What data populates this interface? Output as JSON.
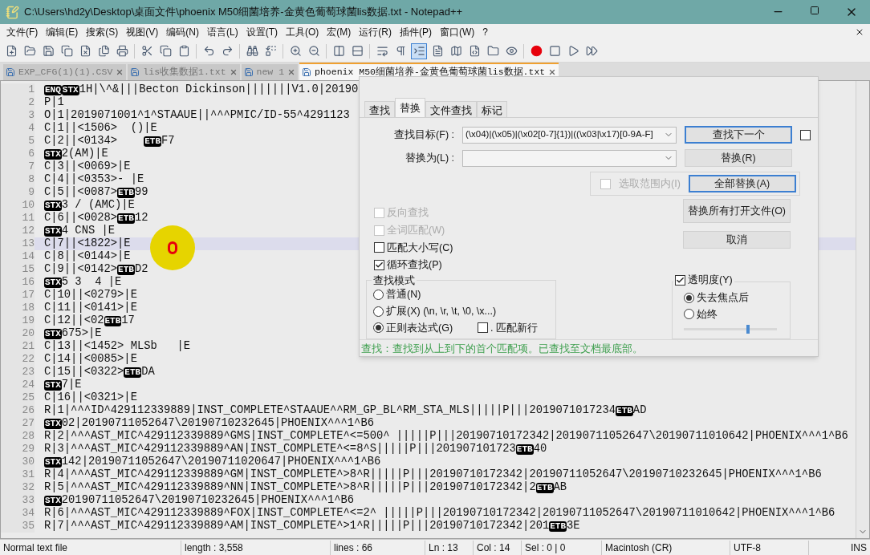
{
  "window": {
    "title": "C:\\Users\\hd2y\\Desktop\\桌面文件\\phoenix M50细菌培养-金黄色葡萄球菌lis数据.txt - Notepad++"
  },
  "menu": [
    "文件(F)",
    "编辑(E)",
    "搜索(S)",
    "视图(V)",
    "编码(N)",
    "语言(L)",
    "设置(T)",
    "工具(O)",
    "宏(M)",
    "运行(R)",
    "插件(P)",
    "窗口(W)",
    "?"
  ],
  "tabs": [
    {
      "label": "EXP_CFG(1)(1).CSV",
      "selected": false
    },
    {
      "label": "lis收集数据1.txt",
      "selected": false
    },
    {
      "label": "new 1",
      "selected": false
    },
    {
      "label": "phoenix M50细菌培养-金黄色葡萄球菌lis数据.txt",
      "selected": true
    }
  ],
  "editor": {
    "lines": [
      {
        "number": "1",
        "current": false,
        "segments": [
          {
            "kind": "ctrl",
            "text": "ENQ"
          },
          {
            "kind": "ctrl",
            "text": "STX"
          },
          {
            "kind": "text",
            "text": "1H|\\^&|||Becton Dickinson|||||||V1.0|20190"
          }
        ]
      },
      {
        "number": "2",
        "current": false,
        "segments": [
          {
            "kind": "text",
            "text": "P|1"
          }
        ]
      },
      {
        "number": "3",
        "current": false,
        "segments": [
          {
            "kind": "text",
            "text": "O|1|2019071001^1^STAAUE||^^^PMIC/ID-55^4291123"
          }
        ]
      },
      {
        "number": "4",
        "current": false,
        "segments": [
          {
            "kind": "text",
            "text": "C|1||<1506>  ()|E"
          }
        ]
      },
      {
        "number": "5",
        "current": false,
        "segments": [
          {
            "kind": "text",
            "text": "C|2||<0134>    "
          },
          {
            "kind": "ctrl",
            "text": "ETB"
          },
          {
            "kind": "text",
            "text": "F7"
          }
        ]
      },
      {
        "number": "6",
        "current": false,
        "segments": [
          {
            "kind": "ctrl",
            "text": "STX"
          },
          {
            "kind": "text",
            "text": "2(AM)|E"
          }
        ]
      },
      {
        "number": "7",
        "current": false,
        "segments": [
          {
            "kind": "text",
            "text": "C|3||<0069>|E"
          }
        ]
      },
      {
        "number": "8",
        "current": false,
        "segments": [
          {
            "kind": "text",
            "text": "C|4||<0353>- |E"
          }
        ]
      },
      {
        "number": "9",
        "current": false,
        "segments": [
          {
            "kind": "text",
            "text": "C|5||<0087>"
          },
          {
            "kind": "ctrl",
            "text": "ETB"
          },
          {
            "kind": "text",
            "text": "99"
          }
        ]
      },
      {
        "number": "10",
        "current": false,
        "segments": [
          {
            "kind": "ctrl",
            "text": "STX"
          },
          {
            "kind": "text",
            "text": "3 / (AMC)|E"
          }
        ]
      },
      {
        "number": "11",
        "current": false,
        "segments": [
          {
            "kind": "text",
            "text": "C|6||<0028>"
          },
          {
            "kind": "ctrl",
            "text": "ETB"
          },
          {
            "kind": "text",
            "text": "12"
          }
        ]
      },
      {
        "number": "12",
        "current": false,
        "segments": [
          {
            "kind": "ctrl",
            "text": "STX"
          },
          {
            "kind": "text",
            "text": "4 CNS |E"
          }
        ]
      },
      {
        "number": "13",
        "current": true,
        "segments": [
          {
            "kind": "text",
            "text": "C|7||<1822>|E"
          }
        ]
      },
      {
        "number": "14",
        "current": false,
        "segments": [
          {
            "kind": "text",
            "text": "C|8||<0144>|E"
          }
        ]
      },
      {
        "number": "15",
        "current": false,
        "segments": [
          {
            "kind": "text",
            "text": "C|9||<0142>"
          },
          {
            "kind": "ctrl",
            "text": "ETB"
          },
          {
            "kind": "text",
            "text": "D2"
          }
        ]
      },
      {
        "number": "16",
        "current": false,
        "segments": [
          {
            "kind": "ctrl",
            "text": "STX"
          },
          {
            "kind": "text",
            "text": "5 3  4 |E"
          }
        ]
      },
      {
        "number": "17",
        "current": false,
        "segments": [
          {
            "kind": "text",
            "text": "C|10||<0279>|E"
          }
        ]
      },
      {
        "number": "18",
        "current": false,
        "segments": [
          {
            "kind": "text",
            "text": "C|11||<0141>|E"
          }
        ]
      },
      {
        "number": "19",
        "current": false,
        "segments": [
          {
            "kind": "text",
            "text": "C|12||<02"
          },
          {
            "kind": "ctrl",
            "text": "ETB"
          },
          {
            "kind": "text",
            "text": "17"
          }
        ]
      },
      {
        "number": "20",
        "current": false,
        "segments": [
          {
            "kind": "ctrl",
            "text": "STX"
          },
          {
            "kind": "text",
            "text": "675>|E"
          }
        ]
      },
      {
        "number": "21",
        "current": false,
        "segments": [
          {
            "kind": "text",
            "text": "C|13||<1452> MLSb   |E"
          }
        ]
      },
      {
        "number": "22",
        "current": false,
        "segments": [
          {
            "kind": "text",
            "text": "C|14||<0085>|E"
          }
        ]
      },
      {
        "number": "23",
        "current": false,
        "segments": [
          {
            "kind": "text",
            "text": "C|15||<0322>"
          },
          {
            "kind": "ctrl",
            "text": "ETB"
          },
          {
            "kind": "text",
            "text": "DA"
          }
        ]
      },
      {
        "number": "24",
        "current": false,
        "segments": [
          {
            "kind": "ctrl",
            "text": "STX"
          },
          {
            "kind": "text",
            "text": "7|E"
          }
        ]
      },
      {
        "number": "25",
        "current": false,
        "segments": [
          {
            "kind": "text",
            "text": "C|16||<0321>|E"
          }
        ]
      },
      {
        "number": "26",
        "current": false,
        "segments": [
          {
            "kind": "text",
            "text": "R|1|^^^ID^429112339889|INST_COMPLETE^STAAUE^^RM_GP_BL^RM_STA_MLS|||||P|||2019071017234"
          },
          {
            "kind": "ctrl",
            "text": "ETB"
          },
          {
            "kind": "text",
            "text": "AD"
          }
        ]
      },
      {
        "number": "27",
        "current": false,
        "segments": [
          {
            "kind": "ctrl",
            "text": "STX"
          },
          {
            "kind": "text",
            "text": "02|20190711052647\\20190710232645|PHOENIX^^^1^B6"
          }
        ]
      },
      {
        "number": "28",
        "current": false,
        "segments": [
          {
            "kind": "text",
            "text": "R|2|^^^AST_MIC^429112339889^GMS|INST_COMPLETE^<=500^ |||||P|||20190710172342|20190711052647\\20190711010642|PHOENIX^^^1^B6"
          }
        ]
      },
      {
        "number": "29",
        "current": false,
        "segments": [
          {
            "kind": "text",
            "text": "R|3|^^^AST_MIC^429112339889^AN|INST_COMPLETE^<=8^S|||||P|||201907101723"
          },
          {
            "kind": "ctrl",
            "text": "ETB"
          },
          {
            "kind": "text",
            "text": "40"
          }
        ]
      },
      {
        "number": "30",
        "current": false,
        "segments": [
          {
            "kind": "ctrl",
            "text": "STX"
          },
          {
            "kind": "text",
            "text": "142|20190711052647\\20190711020647|PHOENIX^^^1^B6"
          }
        ]
      },
      {
        "number": "31",
        "current": false,
        "segments": [
          {
            "kind": "text",
            "text": "R|4|^^^AST_MIC^429112339889^GM|INST_COMPLETE^>8^R|||||P|||20190710172342|20190711052647\\20190710232645|PHOENIX^^^1^B6"
          }
        ]
      },
      {
        "number": "32",
        "current": false,
        "segments": [
          {
            "kind": "text",
            "text": "R|5|^^^AST_MIC^429112339889^NN|INST_COMPLETE^>8^R|||||P|||20190710172342|2"
          },
          {
            "kind": "ctrl",
            "text": "ETB"
          },
          {
            "kind": "text",
            "text": "AB"
          }
        ]
      },
      {
        "number": "33",
        "current": false,
        "segments": [
          {
            "kind": "ctrl",
            "text": "STX"
          },
          {
            "kind": "text",
            "text": "20190711052647\\20190710232645|PHOENIX^^^1^B6"
          }
        ]
      },
      {
        "number": "34",
        "current": false,
        "segments": [
          {
            "kind": "text",
            "text": "R|6|^^^AST_MIC^429112339889^FOX|INST_COMPLETE^<=2^ |||||P|||20190710172342|20190711052647\\20190711010642|PHOENIX^^^1^B6"
          }
        ]
      },
      {
        "number": "35",
        "current": false,
        "segments": [
          {
            "kind": "text",
            "text": "R|7|^^^AST_MIC^429112339889^AM|INST_COMPLETE^>1^R|||||P|||20190710172342|201"
          },
          {
            "kind": "ctrl",
            "text": "ETB"
          },
          {
            "kind": "text",
            "text": "3E"
          }
        ]
      }
    ]
  },
  "find_dialog": {
    "tabs": [
      {
        "label": "查找",
        "selected": false
      },
      {
        "label": "替换",
        "selected": true
      },
      {
        "label": "文件查找",
        "selected": false
      },
      {
        "label": "标记",
        "selected": false
      }
    ],
    "find_field": {
      "label": "查找目标(F) :",
      "value": "(\\x04)|(\\x05)|(\\x02[0-7]{1})|((\\x03|\\x17)[0-9A-F]"
    },
    "replace_field": {
      "label": "替换为(L) :"
    },
    "buttons": [
      {
        "label": "查找下一个",
        "highlighted": true
      },
      {
        "label": "替换(R)",
        "highlighted": false
      },
      {
        "label": "全部替换(A)",
        "highlighted": true
      },
      {
        "label": "替换所有打开文件(O)",
        "highlighted": false
      },
      {
        "label": "取消",
        "highlighted": false
      }
    ],
    "side_checkbox": {
      "checked": false
    },
    "in_selection": {
      "label": "选取范围内(I)",
      "checked": false,
      "disabled": true
    },
    "options": [
      {
        "label": "反向查找",
        "checked": false,
        "disabled": true
      },
      {
        "label": "全词匹配(W)",
        "checked": false,
        "disabled": true
      },
      {
        "label": "匹配大小写(C)",
        "checked": false,
        "disabled": false
      },
      {
        "label": "循环查找(P)",
        "checked": true,
        "disabled": false
      }
    ],
    "search_mode": {
      "title": "查找模式",
      "modes": [
        {
          "label": "普通(N)",
          "selected": false
        },
        {
          "label": "扩展(X) (\\n, \\r, \\t, \\0, \\x...)",
          "selected": false
        },
        {
          "label": "正则表达式(G)",
          "selected": true
        }
      ],
      "dot_newline": {
        "label": ". 匹配新行",
        "checked": false
      }
    },
    "transparency": {
      "label": "透明度(Y)",
      "checked": true,
      "options": [
        {
          "label": "失去焦点后",
          "selected": true
        },
        {
          "label": "始终",
          "selected": false
        }
      ],
      "level": 0.7
    },
    "message": "查找：查找到从上到下的首个匹配项。已查找至文档最底部。"
  },
  "status_bar": [
    "Normal text file",
    "length : 3,558",
    "lines : 66",
    "Ln : 13",
    "Col : 14",
    "Sel : 0 | 0",
    "Macintosh (CR)",
    "UTF-8",
    "INS"
  ]
}
